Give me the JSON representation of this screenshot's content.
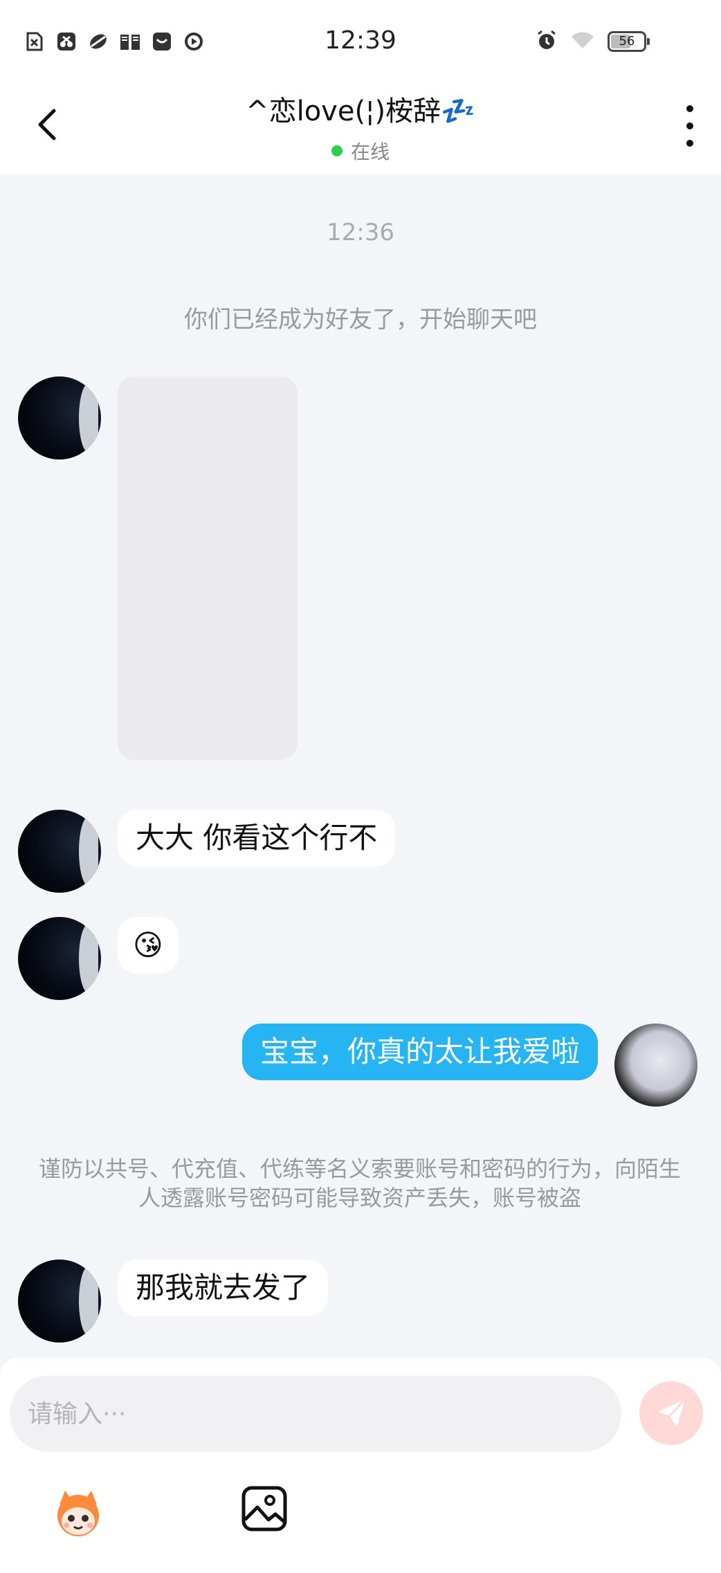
{
  "status_bar": {
    "time": "12:39",
    "battery": "56",
    "left_icons": [
      "sim-off-icon",
      "screenshot-icon",
      "app-icon",
      "book-icon",
      "mail-icon",
      "play-icon"
    ],
    "right_icons": [
      "alarm-icon",
      "wifi-icon"
    ]
  },
  "header": {
    "title": "^恋love(¦)桉辞💤",
    "status": "在线"
  },
  "chat": {
    "timestamp": "12:36",
    "system_message": "你们已经成为好友了，开始聊天吧",
    "messages": [
      {
        "from": "other",
        "type": "image"
      },
      {
        "from": "other",
        "type": "text",
        "text": "大大 你看这个行不"
      },
      {
        "from": "other",
        "type": "emoji",
        "text": "😘"
      },
      {
        "from": "me",
        "type": "text",
        "text": "宝宝，你真的太让我爱啦"
      },
      {
        "from": "other",
        "type": "text",
        "text": "那我就去发了"
      }
    ],
    "warning": "谨防以共号、代充值、代练等名义索要账号和密码的行为，向陌生人透露账号密码可能导致资产丢失，账号被盗"
  },
  "composer": {
    "placeholder": "请输入···",
    "value": ""
  },
  "colors": {
    "accent": "#27b4f2",
    "online": "#2ecf4f",
    "background": "#f4f5f8",
    "send_disabled": "#ffd9d6"
  }
}
